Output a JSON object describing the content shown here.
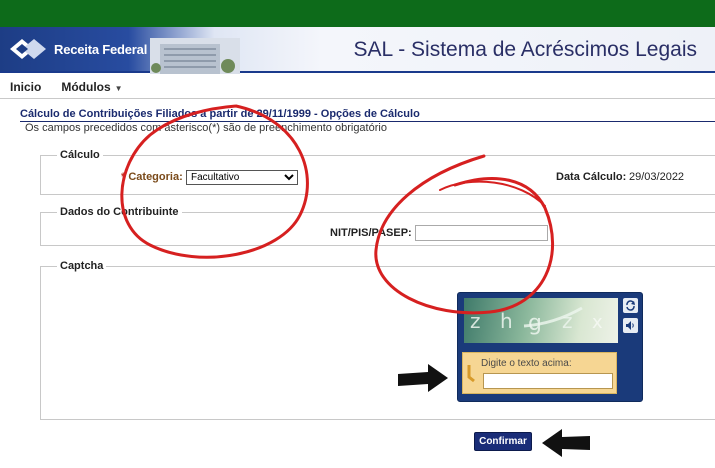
{
  "header": {
    "brand_name": "Receita Federal",
    "app_title": "SAL - Sistema de Acréscimos Legais"
  },
  "menu": {
    "items": [
      {
        "label": "Inicio"
      },
      {
        "label": "Módulos"
      }
    ]
  },
  "page": {
    "title": "Cálculo de Contribuições Filiados a partir de 29/11/1999 - Opções de Cálculo",
    "required_note": "Os campos precedidos com asterisco(*) são de preenchimento obrigatório"
  },
  "calculo": {
    "legend": "Cálculo",
    "categoria_label": "Categoria:",
    "required_mark": "*",
    "categoria_value": "Facultativo",
    "data_calculo_label": "Data Cálculo:",
    "data_calculo_value": "29/03/2022"
  },
  "contribuinte": {
    "legend": "Dados do Contribuinte",
    "nit_label": "NIT/PIS/PASEP:",
    "nit_value": ""
  },
  "captcha": {
    "legend": "Captcha",
    "prompt": "Digite o texto acima:",
    "input_value": "",
    "icons": [
      "refresh-icon",
      "audio-icon"
    ]
  },
  "actions": {
    "confirm_label": "Confirmar"
  },
  "colors": {
    "top_bar": "#0d6b1a",
    "header_blue": "#1d3d85",
    "title_blue": "#1a2a6e",
    "button_blue": "#1a2d78",
    "annotation_red": "#d62020"
  }
}
